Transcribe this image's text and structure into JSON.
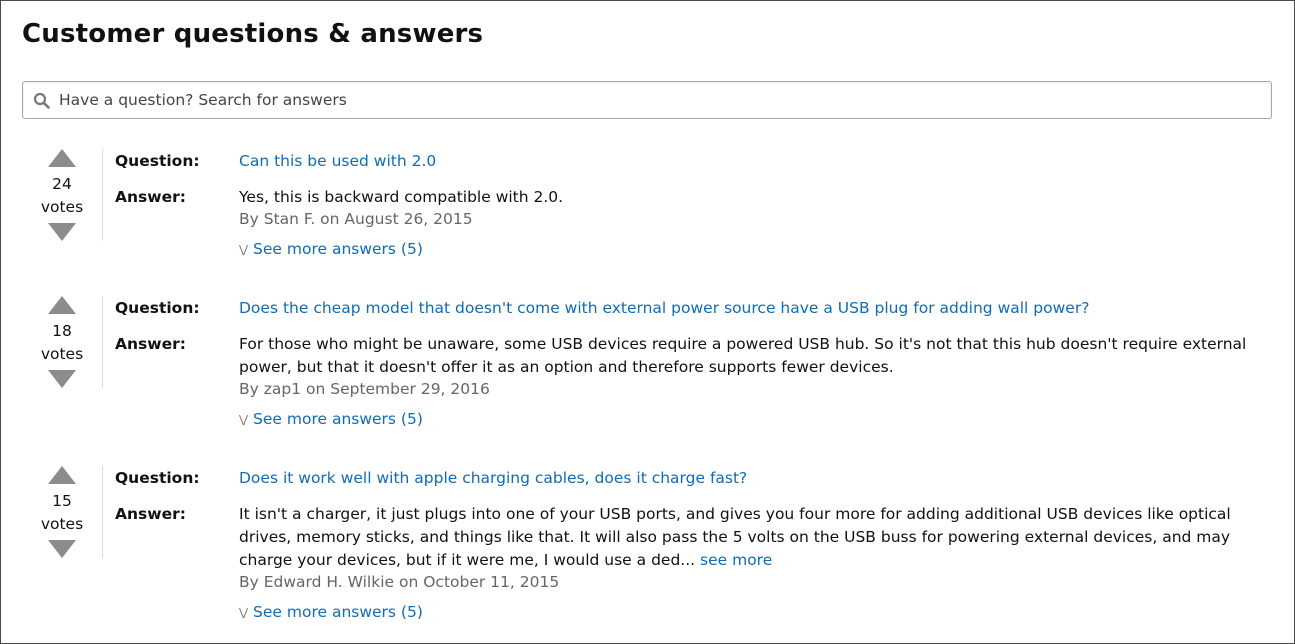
{
  "page": {
    "title": "Customer questions & answers"
  },
  "search": {
    "placeholder": "Have a question? Search for answers",
    "icon": "search-icon"
  },
  "labels": {
    "question": "Question:",
    "answer": "Answer:",
    "votes": "votes"
  },
  "colors": {
    "link": "#0f6cb6",
    "byline": "#666666",
    "vote_arrow": "#8c8c8c"
  },
  "qa": [
    {
      "votes": "24",
      "question": "Can this be used with 2.0",
      "answer": "Yes, this is backward compatible with 2.0.",
      "answer_more": "",
      "byline": "By Stan F. on August 26, 2015",
      "see_more": "See more answers (5)"
    },
    {
      "votes": "18",
      "question": "Does the cheap model that doesn't come with external power source have a USB plug for adding wall power?",
      "answer": "For those who might be unaware, some USB devices require a powered USB hub. So it's not that this hub doesn't require external power, but that it doesn't offer it as an option and therefore supports fewer devices.",
      "answer_more": "",
      "byline": "By zap1 on September 29, 2016",
      "see_more": "See more answers (5)"
    },
    {
      "votes": "15",
      "question": "Does it work well with apple charging cables, does it charge fast?",
      "answer": "It isn't a charger, it just plugs into one of your USB ports, and gives you four more for adding additional USB devices like optical drives, memory sticks, and things like that. It will also pass the 5 volts on the USB buss for powering external devices, and may charge your devices, but if it were me, I would use a ded...",
      "answer_more": "see more",
      "byline": "By Edward H. Wilkie on October 11, 2015",
      "see_more": "See more answers (5)"
    }
  ]
}
